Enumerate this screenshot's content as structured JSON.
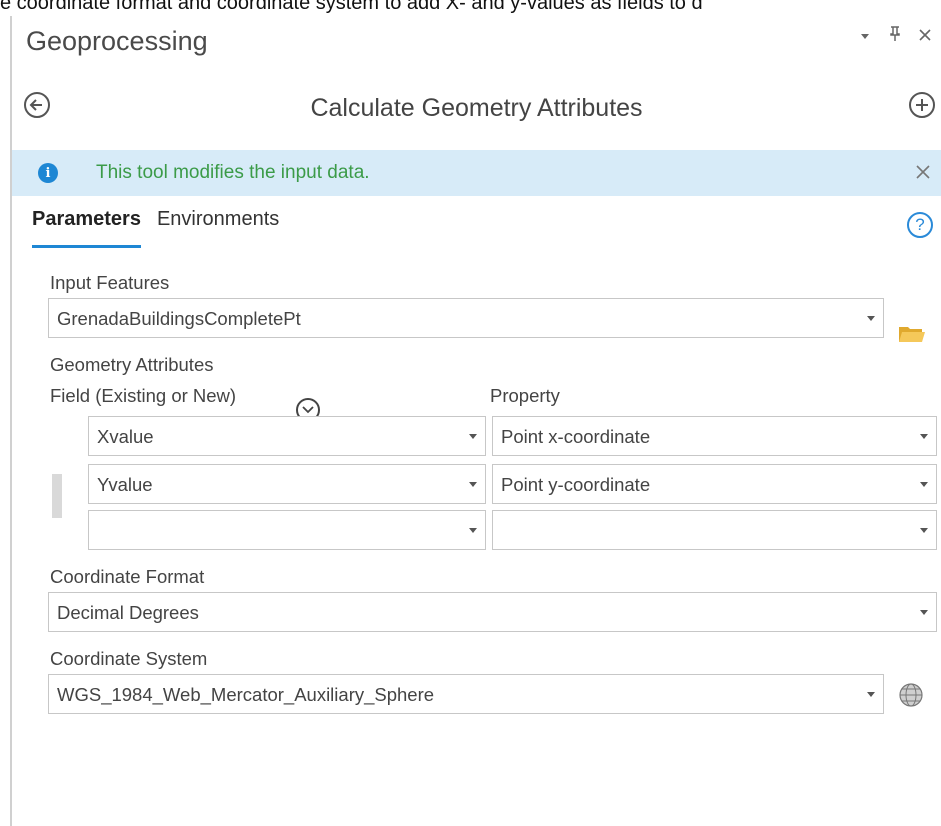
{
  "caption": "e coordinate format and coordinate system to add X- and y-values as fields to d",
  "window": {
    "title": "Geoprocessing",
    "controls": [
      "dropdown-icon",
      "pin-icon",
      "close-icon"
    ]
  },
  "tool": {
    "title": "Calculate Geometry Attributes"
  },
  "info": {
    "message": "This tool modifies the input data."
  },
  "tabs": [
    {
      "label": "Parameters",
      "active": true
    },
    {
      "label": "Environments",
      "active": false
    }
  ],
  "input_features": {
    "label": "Input Features",
    "value": "GrenadaBuildingsCompletePt"
  },
  "geometry_attributes": {
    "label": "Geometry Attributes",
    "field_header": "Field (Existing or New)",
    "property_header": "Property",
    "rows": [
      {
        "field": "Xvalue",
        "property": "Point x-coordinate"
      },
      {
        "field": "Yvalue",
        "property": "Point y-coordinate"
      },
      {
        "field": "",
        "property": ""
      }
    ]
  },
  "coordinate_format": {
    "label": "Coordinate Format",
    "value": "Decimal Degrees"
  },
  "coordinate_system": {
    "label": "Coordinate System",
    "value": "WGS_1984_Web_Mercator_Auxiliary_Sphere"
  },
  "colors": {
    "accent": "#1e87d4",
    "info_bg": "#d7ebf8",
    "info_text": "#3b9b48",
    "folder": "#f2c14e"
  }
}
